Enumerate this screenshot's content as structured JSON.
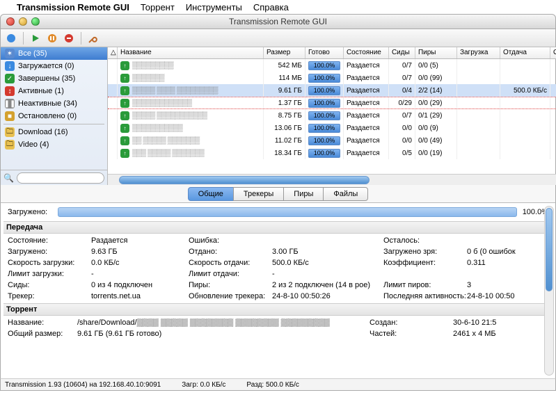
{
  "menubar": {
    "apple": "",
    "app": "Transmission Remote GUI",
    "items": [
      "Торрент",
      "Инструменты",
      "Справка"
    ]
  },
  "window": {
    "title": "Transmission Remote GUI"
  },
  "toolbar_icons": [
    "connect-icon",
    "play-icon",
    "pause-icon",
    "settings-icon",
    "wrench-icon"
  ],
  "sidebar": {
    "filters": [
      {
        "icon": "star",
        "color": "#5a8ad0",
        "label": "Все (35)",
        "selected": true
      },
      {
        "icon": "down",
        "color": "#3a8ae0",
        "label": "Загружается (0)"
      },
      {
        "icon": "check",
        "color": "#2a9b3a",
        "label": "Завершены (35)"
      },
      {
        "icon": "up",
        "color": "#d43a2f",
        "label": "Активные (1)"
      },
      {
        "icon": "pause",
        "color": "#888",
        "label": "Неактивные (34)"
      },
      {
        "icon": "stop",
        "color": "#d4a12f",
        "label": "Остановлено (0)"
      }
    ],
    "folders": [
      {
        "label": "Download (16)"
      },
      {
        "label": "Video (4)"
      }
    ],
    "search_placeholder": ""
  },
  "columns": {
    "tri": "△",
    "name": "Название",
    "size": "Размер",
    "done": "Готово",
    "state": "Состояние",
    "seeds": "Сиды",
    "peers": "Пиры",
    "dl": "Загрузка",
    "ul": "Отдача",
    "last": "О"
  },
  "torrents": [
    {
      "name": "▒▒▒▒▒▒▒▒▒",
      "size": "542 МБ",
      "done": "100.0%",
      "state": "Раздается",
      "seeds": "0/7",
      "peers": "0/0 (5)",
      "dl": "",
      "ul": ""
    },
    {
      "name": "▒▒▒▒▒▒▒",
      "size": "114 МБ",
      "done": "100.0%",
      "state": "Раздается",
      "seeds": "0/7",
      "peers": "0/0 (99)",
      "dl": "",
      "ul": ""
    },
    {
      "name": "▒▒▒▒▒ ▒▒▒▒ ▒▒▒▒▒▒▒▒▒",
      "size": "9.61 ГБ",
      "done": "100.0%",
      "state": "Раздается",
      "seeds": "0/4",
      "peers": "2/2 (14)",
      "dl": "",
      "ul": "500.0 КБ/с",
      "selected": true
    },
    {
      "name": "▒▒▒▒▒▒▒▒▒▒▒▒▒",
      "size": "1.37 ГБ",
      "done": "100.0%",
      "state": "Раздается",
      "seeds": "0/29",
      "peers": "0/0 (29)",
      "dl": "",
      "ul": "",
      "redline": true
    },
    {
      "name": "▒▒▒▒▒  ▒▒▒▒▒▒▒▒▒▒▒",
      "size": "8.75 ГБ",
      "done": "100.0%",
      "state": "Раздается",
      "seeds": "0/7",
      "peers": "0/1 (29)",
      "dl": "",
      "ul": ""
    },
    {
      "name": "▒▒▒▒▒▒▒▒▒▒▒",
      "size": "13.06 ГБ",
      "done": "100.0%",
      "state": "Раздается",
      "seeds": "0/0",
      "peers": "0/0 (9)",
      "dl": "",
      "ul": ""
    },
    {
      "name": "▒▒ ▒▒▒▒▒  ▒▒▒▒▒▒▒",
      "size": "11.02 ГБ",
      "done": "100.0%",
      "state": "Раздается",
      "seeds": "0/0",
      "peers": "0/0 (49)",
      "dl": "",
      "ul": ""
    },
    {
      "name": "▒▒▒ ▒▒▒▒▒   ▒▒▒▒▒▒▒",
      "size": "18.34 ГБ",
      "done": "100.0%",
      "state": "Раздается",
      "seeds": "0/5",
      "peers": "0/0 (19)",
      "dl": "",
      "ul": ""
    }
  ],
  "tabs": [
    "Общие",
    "Трекеры",
    "Пиры",
    "Файлы"
  ],
  "active_tab": 0,
  "details": {
    "downloaded_label": "Загружено:",
    "downloaded_pct": "100.0%",
    "section_transfer": "Передача",
    "section_torrent": "Торрент",
    "rows": {
      "state_k": "Состояние:",
      "state_v": "Раздается",
      "error_k": "Ошибка:",
      "error_v": "",
      "remain_k": "Осталось:",
      "remain_v": "",
      "downloaded_k": "Загружено:",
      "downloaded_v": "9.63 ГБ",
      "uploaded_k": "Отдано:",
      "uploaded_v": "3.00 ГБ",
      "wasted_k": "Загружено зря:",
      "wasted_v": "0 б (0 ошибок",
      "dlspeed_k": "Скорость загрузки:",
      "dlspeed_v": "0.0 КБ/с",
      "ulspeed_k": "Скорость отдачи:",
      "ulspeed_v": "500.0 КБ/с",
      "ratio_k": "Коэффициент:",
      "ratio_v": "0.311",
      "dllimit_k": "Лимит загрузки:",
      "dllimit_v": "-",
      "ullimit_k": "Лимит отдачи:",
      "ullimit_v": "-",
      "seeds_k": "Сиды:",
      "seeds_v": "0 из 4 подключен",
      "peers_k": "Пиры:",
      "peers_v": "2 из 2 подключен (14 в рое)",
      "peerlimit_k": "Лимит пиров:",
      "peerlimit_v": "3",
      "tracker_k": "Трекер:",
      "tracker_v": "torrents.net.ua",
      "trackerupd_k": "Обновление трекера:",
      "trackerupd_v": "24-8-10 00:50:26",
      "lastact_k": "Последняя активность:",
      "lastact_v": "24-8-10 00:50",
      "name_k": "Название:",
      "name_v": "/share/Download/▒▒▒▒ ▒▒▒▒▒ ▒▒▒▒▒▒▒▒ ▒▒▒▒▒▒▒▒ ▒▒▒▒▒▒▒▒▒",
      "created_k": "Создан:",
      "created_v": "30-6-10 21:5",
      "totsize_k": "Общий размер:",
      "totsize_v": "9.61 ГБ (9.61 ГБ готово)",
      "pieces_k": "Частей:",
      "pieces_v": "2461 x 4 МБ"
    }
  },
  "statusbar": {
    "left": "Transmission 1.93 (10604) на 192.168.40.10:9091",
    "dl": "Загр: 0.0 КБ/с",
    "ul": "Разд: 500.0 КБ/с"
  }
}
